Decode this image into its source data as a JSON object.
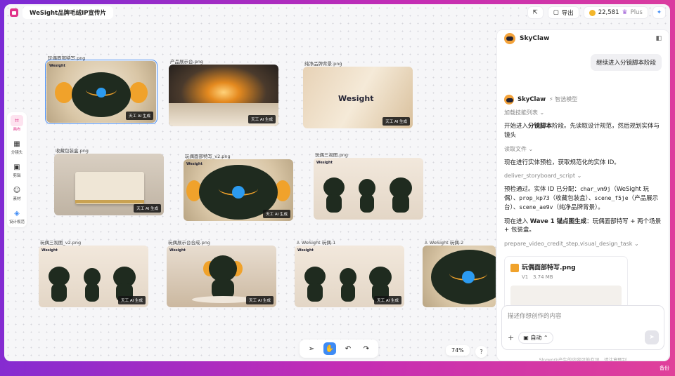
{
  "window": {
    "title": "WeSight品牌毛绒IP宣传片"
  },
  "topbar": {
    "export": "导出",
    "credits": "22,581",
    "plan": "Plus"
  },
  "sidebar": [
    {
      "label": "画布"
    },
    {
      "label": "分镜头"
    },
    {
      "label": "剪辑"
    },
    {
      "label": "素材"
    },
    {
      "label": "设计规范"
    }
  ],
  "canvas": {
    "ai_badge": "天工 AI 生成",
    "brand": "Wesight",
    "cards": [
      {
        "label": "玩偶面部特写.png"
      },
      {
        "label": "产品展示台.png"
      },
      {
        "label": "纯净品牌背景.png"
      },
      {
        "label": "收藏包装盒.png"
      },
      {
        "label": "玩偶面部特写_v2.png"
      },
      {
        "label": "玩偶三视图.png"
      },
      {
        "label": "玩偶三视图_v2.png"
      },
      {
        "label": "玩偶展示台合成.png"
      },
      {
        "label": "WeSight 玩偶-1"
      },
      {
        "label": "WeSight 玩偶-2"
      }
    ]
  },
  "chat": {
    "title": "SkyClaw",
    "user_msg": "继续进入分镜脚本阶段",
    "agent": {
      "name": "SkyClaw",
      "model": "智选模型"
    },
    "load_skills": "加载技能列表",
    "line1_pre": "开始进入",
    "line1_bold": "分镜脚本",
    "line1_post": "阶段。先读取设计规范，然后规划实体与镜头",
    "read_file": "读取文件",
    "line2": "现在进行实体预检，获取规范化的实体 ID。",
    "tool1": "deliver_storyboard_script",
    "line3_pre": "预检通过。实体 ID 已分配：",
    "id1": "char_vm9j",
    "id1_desc": "（WeSight 玩偶）、",
    "id2": "prop_kp73",
    "id2_desc": "（收藏包装盒）、",
    "id3": "scene_f5je",
    "id3_desc": "（产品展示台）、",
    "id4": "scene_ae9v",
    "id4_desc": "（纯净品牌背景）。",
    "line4_pre": "现在进入 ",
    "line4_bold": "Wave 1 锚点图生成",
    "line4_post": "：玩偶面部特写 + 两个场景 + 包装盒。",
    "tool2": "prepare_video_credit_step,visual_design_task",
    "file": {
      "name": "玩偶面部特写.png",
      "version": "V1",
      "size": "3.74 MB"
    },
    "input_placeholder": "描述你想创作的内容",
    "mode": "自动",
    "disclaimer": "Skywork产生的内容可能有误，请注意甄别"
  },
  "bottom": {
    "zoom": "74%",
    "help": "?"
  },
  "footer_right": "备份"
}
